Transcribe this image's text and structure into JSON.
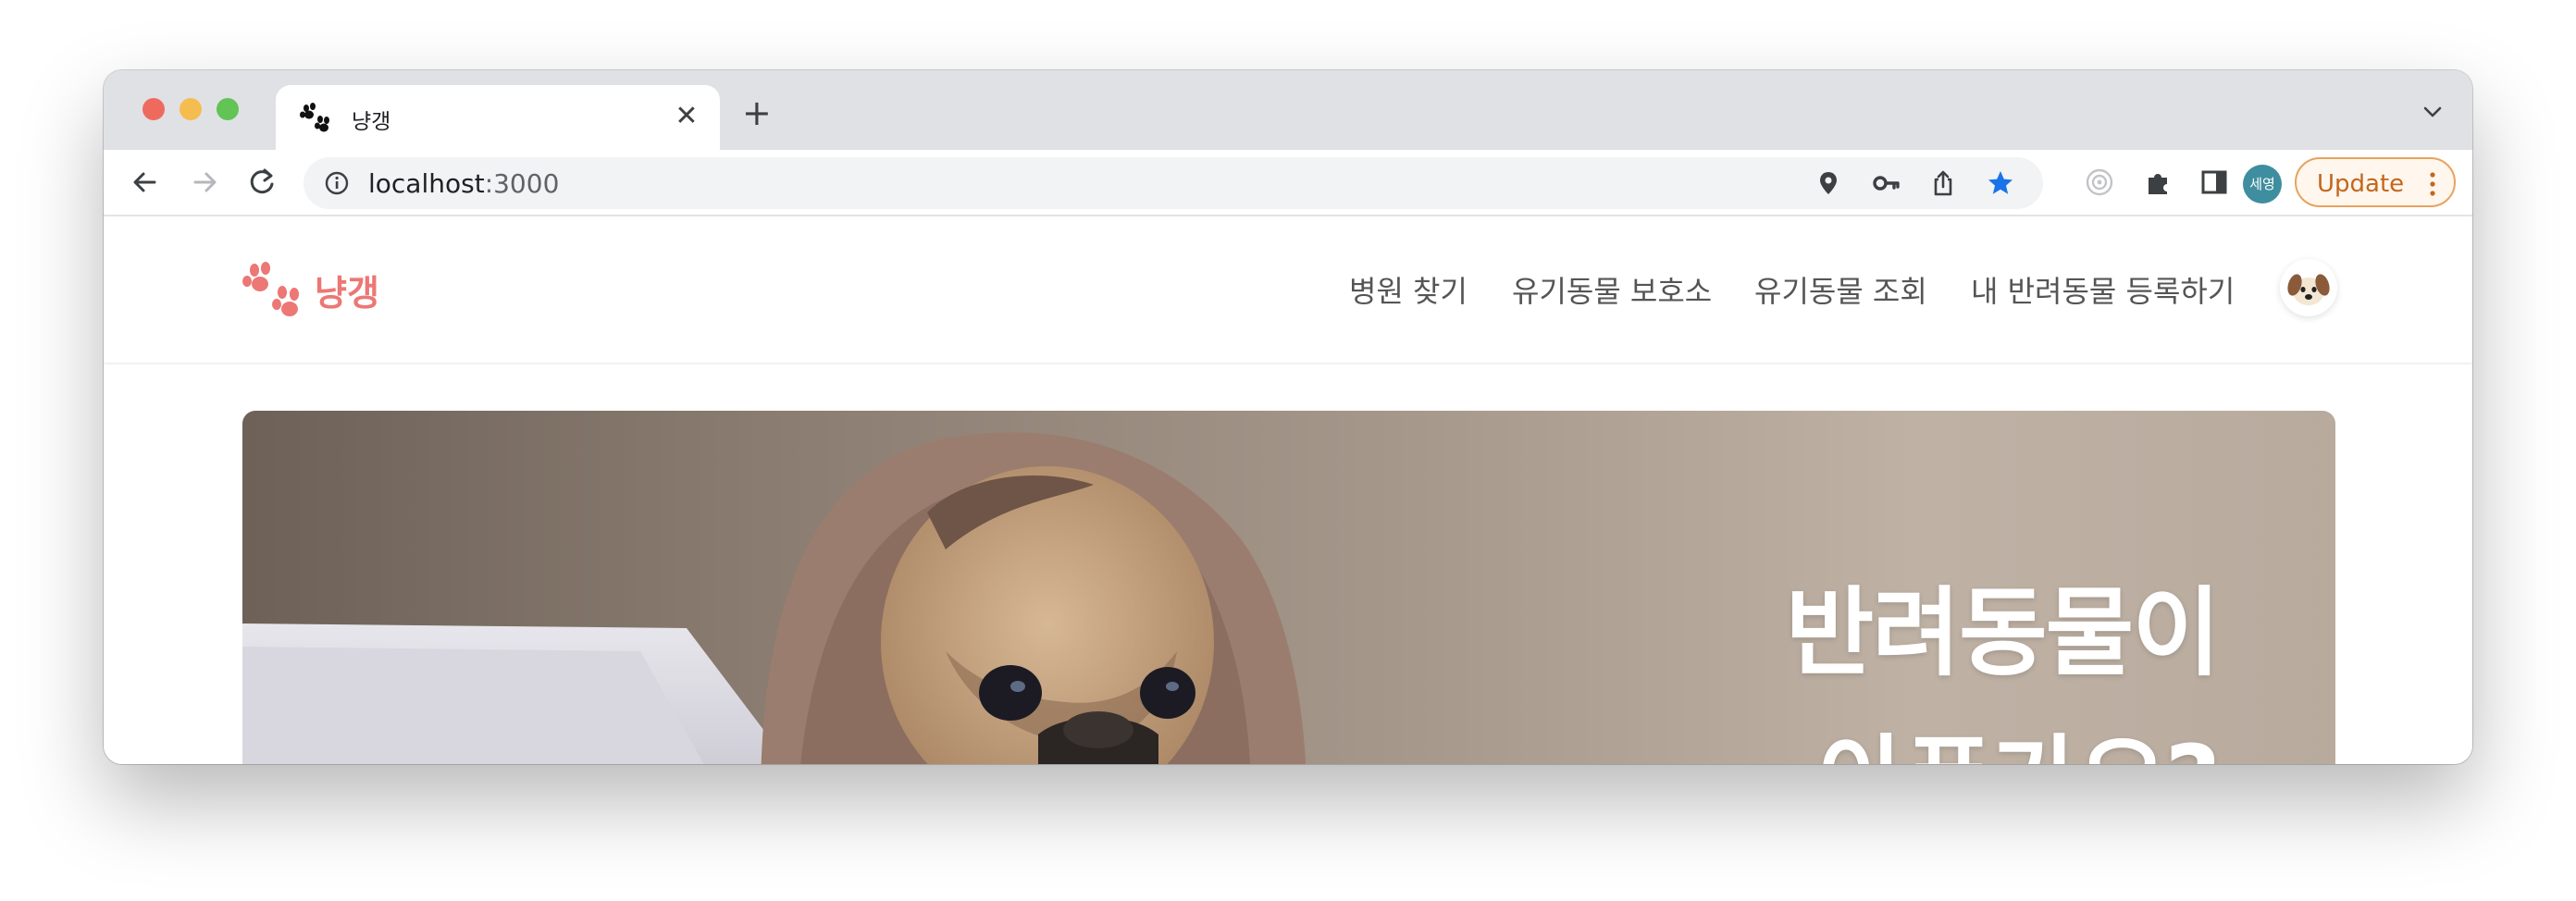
{
  "browser": {
    "tab": {
      "title": "냥갱",
      "close_glyph": "✕",
      "icon": "paw-icon"
    },
    "new_tab_glyph": "+",
    "address": {
      "host": "localhost",
      "port": ":3000"
    },
    "profile_initials": "세영",
    "update_label": "Update"
  },
  "site": {
    "logo_text": "냥갱",
    "nav": [
      {
        "label": "병원 찾기"
      },
      {
        "label": "유기동물 보호소"
      },
      {
        "label": "유기동물 조회"
      },
      {
        "label": "내 반려동물 등록하기"
      }
    ],
    "hero": {
      "title_line1": "반려동물이",
      "title_line2": "아픈가요?"
    }
  },
  "colors": {
    "brand": "#ec7774",
    "update_accent": "#c4661b",
    "bookmark_star": "#1a73e8"
  }
}
